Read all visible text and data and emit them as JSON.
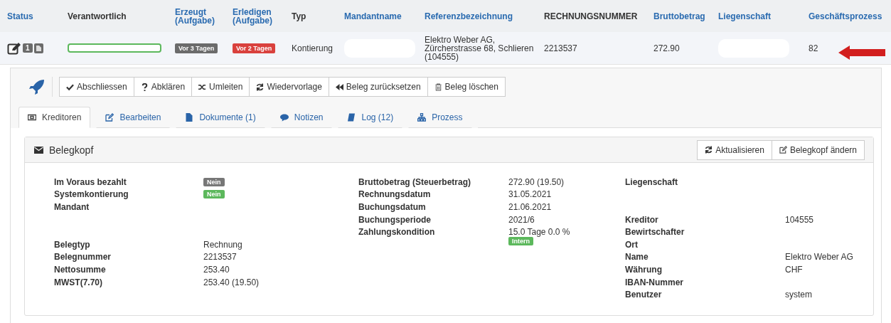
{
  "table": {
    "columns": [
      {
        "label": "Status",
        "sortable": true
      },
      {
        "label": "Verantwortlich",
        "sortable": false
      },
      {
        "label": "Erzeugt (Aufgabe)",
        "sortable": true
      },
      {
        "label": "Erledigen (Aufgabe)",
        "sortable": true
      },
      {
        "label": "Typ",
        "sortable": false
      },
      {
        "label": "Mandantname",
        "sortable": true
      },
      {
        "label": "Referenzbezeichnung",
        "sortable": true
      },
      {
        "label": "RECHNUNGSNUMMER",
        "sortable": false
      },
      {
        "label": "Bruttobetrag",
        "sortable": true
      },
      {
        "label": "Liegenschaft",
        "sortable": true
      },
      {
        "label": "Geschäftsprozess",
        "sortable": true
      }
    ],
    "row": {
      "document_count": "1",
      "created": {
        "text": "Vor 3 Tagen",
        "color": "#6b6b6b"
      },
      "due": {
        "text": "Vor 2 Tagen",
        "color": "#d9413d"
      },
      "type": "Kontierung",
      "reference": "Elektro Weber AG, Zürcherstrasse 68, Schlieren (104555)",
      "invoice_number": "2213537",
      "gross_amount": "272.90",
      "business_process": "82"
    }
  },
  "toolbar": {
    "buttons": [
      "Abschliessen",
      "Abklären",
      "Umleiten",
      "Wiedervorlage",
      "Beleg zurücksetzen",
      "Beleg löschen"
    ]
  },
  "tabs": [
    {
      "label": "Kreditoren",
      "selected": true
    },
    {
      "label": "Bearbeiten",
      "selected": false
    },
    {
      "label": "Dokumente (1)",
      "selected": false
    },
    {
      "label": "Notizen",
      "selected": false
    },
    {
      "label": "Log (12)",
      "selected": false
    },
    {
      "label": "Prozess",
      "selected": false
    }
  ],
  "panel": {
    "title": "Belegkopf",
    "buttons": [
      "Aktualisieren",
      "Belegkopf ändern"
    ],
    "columns": [
      [
        [
          {
            "label": "Im Voraus bezahlt",
            "badge": {
              "text": "Nein",
              "color": "#777777"
            }
          },
          {
            "label": "Systemkontierung",
            "badge": {
              "text": "Nein",
              "color": "#5cb85c"
            }
          },
          {
            "label": "Mandant"
          }
        ],
        [
          {
            "label": "Belegtyp",
            "value": "Rechnung"
          },
          {
            "label": "Belegnummer",
            "value": "2213537"
          },
          {
            "label": "Nettosumme",
            "value": "253.40"
          },
          {
            "label": "MWST(7.70)",
            "value": "253.40 (19.50)"
          }
        ]
      ],
      [
        [
          {
            "label": "Bruttobetrag (Steuerbetrag)",
            "value": "272.90 (19.50)"
          },
          {
            "label": "Rechnungsdatum",
            "value": "31.05.2021"
          },
          {
            "label": "Buchungsdatum",
            "value": "21.06.2021"
          },
          {
            "label": "Buchungsperiode",
            "value": "2021/6"
          },
          {
            "label": "Zahlungskondition",
            "value": "15.0 Tage 0.0 %",
            "badge": {
              "text": "Intern",
              "color": "#5cb85c"
            }
          }
        ]
      ],
      [
        [
          {
            "label": "Liegenschaft"
          }
        ],
        [
          {
            "label": "Kreditor",
            "value": "104555"
          },
          {
            "label": "Bewirtschafter"
          },
          {
            "label": "Ort"
          },
          {
            "label": "Name",
            "value": "Elektro Weber AG"
          },
          {
            "label": "Währung",
            "value": "CHF"
          },
          {
            "label": "IBAN-Nummer"
          },
          {
            "label": "Benutzer",
            "value": "system"
          }
        ]
      ]
    ]
  }
}
